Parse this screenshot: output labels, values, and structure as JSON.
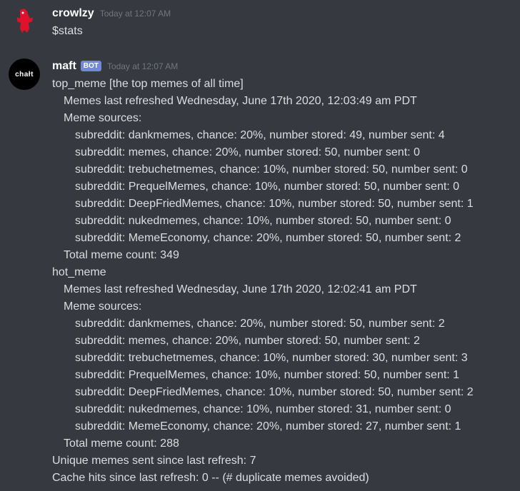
{
  "messages": [
    {
      "username": "crowlzy",
      "timestamp": "Today at 12:07 AM",
      "content": "$stats"
    },
    {
      "username": "maft",
      "bot_tag": "BOT",
      "avatar_text": "chałt",
      "timestamp": "Today at 12:07 AM",
      "lines": [
        {
          "indent": 0,
          "text": "top_meme [the top memes of all time]"
        },
        {
          "indent": 1,
          "text": "Memes last refreshed Wednesday, June 17th 2020, 12:03:49 am PDT"
        },
        {
          "indent": 1,
          "text": "Meme sources:"
        },
        {
          "indent": 2,
          "text": "subreddit: dankmemes, chance: 20%, number stored: 49, number sent: 4"
        },
        {
          "indent": 2,
          "text": "subreddit: memes, chance: 20%, number stored: 50, number sent: 0"
        },
        {
          "indent": 2,
          "text": "subreddit: trebuchetmemes, chance: 10%, number stored: 50, number sent: 0"
        },
        {
          "indent": 2,
          "text": "subreddit: PrequelMemes, chance: 10%, number stored: 50, number sent: 0"
        },
        {
          "indent": 2,
          "text": "subreddit: DeepFriedMemes, chance: 10%, number stored: 50, number sent: 1"
        },
        {
          "indent": 2,
          "text": "subreddit: nukedmemes, chance: 10%, number stored: 50, number sent: 0"
        },
        {
          "indent": 2,
          "text": "subreddit: MemeEconomy, chance: 20%, number stored: 50, number sent: 2"
        },
        {
          "indent": 1,
          "text": "Total meme count: 349"
        },
        {
          "indent": 0,
          "text": "hot_meme"
        },
        {
          "indent": 1,
          "text": "Memes last refreshed Wednesday, June 17th 2020, 12:02:41 am PDT"
        },
        {
          "indent": 1,
          "text": "Meme sources:"
        },
        {
          "indent": 2,
          "text": "subreddit: dankmemes, chance: 20%, number stored: 50, number sent: 2"
        },
        {
          "indent": 2,
          "text": "subreddit: memes, chance: 20%, number stored: 50, number sent: 2"
        },
        {
          "indent": 2,
          "text": "subreddit: trebuchetmemes, chance: 10%, number stored: 30, number sent: 3"
        },
        {
          "indent": 2,
          "text": "subreddit: PrequelMemes, chance: 10%, number stored: 50, number sent: 1"
        },
        {
          "indent": 2,
          "text": "subreddit: DeepFriedMemes, chance: 10%, number stored: 50, number sent: 2"
        },
        {
          "indent": 2,
          "text": "subreddit: nukedmemes, chance: 10%, number stored: 31, number sent: 0"
        },
        {
          "indent": 2,
          "text": "subreddit: MemeEconomy, chance: 20%, number stored: 27, number sent: 1"
        },
        {
          "indent": 1,
          "text": "Total meme count: 288"
        },
        {
          "indent": 0,
          "text": "Unique memes sent since last refresh: 7"
        },
        {
          "indent": 0,
          "text": "Cache hits since last refresh: 0 -- (# duplicate memes avoided)"
        }
      ]
    }
  ],
  "colors": {
    "background": "#36393f",
    "username": "#ffffff",
    "text": "#dcddde",
    "timestamp": "#72767d",
    "bot_tag": "#7289da",
    "avatar_red": "#e0112b"
  }
}
